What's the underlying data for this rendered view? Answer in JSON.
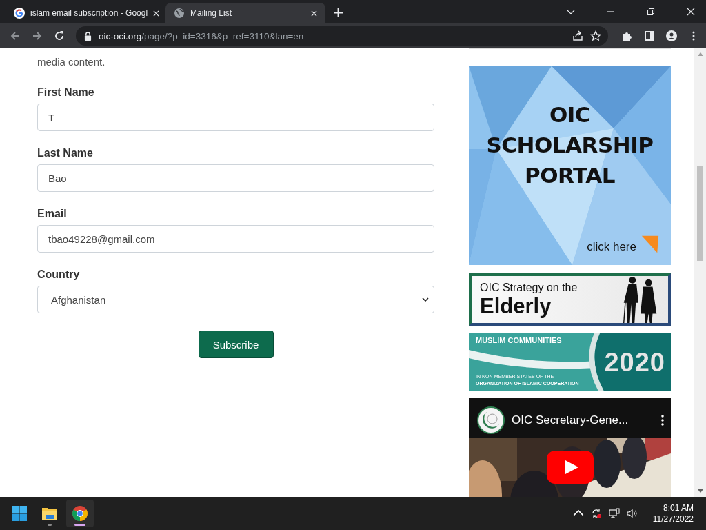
{
  "browser": {
    "tabs": [
      {
        "title": "islam email subscription - Googl",
        "kind": "google",
        "selected": false
      },
      {
        "title": "Mailing List",
        "kind": "globe",
        "selected": true
      }
    ],
    "url": {
      "domain": "oic-oci.org",
      "path": "/page/?p_id=3316&p_ref=3110&lan=en"
    }
  },
  "page": {
    "intro": "media content.",
    "fields": [
      {
        "label": "First Name",
        "value": "T",
        "kind": "text"
      },
      {
        "label": "Last Name",
        "value": "Bao",
        "kind": "text"
      },
      {
        "label": "Email",
        "value": "tbao49228@gmail.com",
        "kind": "text"
      },
      {
        "label": "Country",
        "value": "Afghanistan",
        "kind": "select"
      }
    ],
    "submit": "Subscribe",
    "sidebar": {
      "banners": [
        {
          "kind": "scholarship",
          "lines": [
            "OIC",
            "SCHOLARSHIP",
            "PORTAL"
          ],
          "link": "click here"
        },
        {
          "kind": "elderly",
          "lines": [
            "OIC Strategy on the",
            "Elderly"
          ]
        },
        {
          "kind": "communities",
          "lines": [
            "MUSLIM COMMUNITIES",
            "IN NON-MEMBER STATES OF THE",
            "ORGANIZATION OF ISLAMIC COOPERATION"
          ],
          "year": "2020"
        }
      ],
      "video": {
        "title": "OIC Secretary-Gene..."
      }
    }
  },
  "taskbar": {
    "apps": [
      {
        "kind": "start",
        "running": false,
        "selected": false
      },
      {
        "kind": "explorer",
        "running": true,
        "selected": false
      },
      {
        "kind": "chrome",
        "running": true,
        "selected": true
      }
    ],
    "clock": {
      "time": "8:01 AM",
      "date": "11/27/2022"
    }
  }
}
